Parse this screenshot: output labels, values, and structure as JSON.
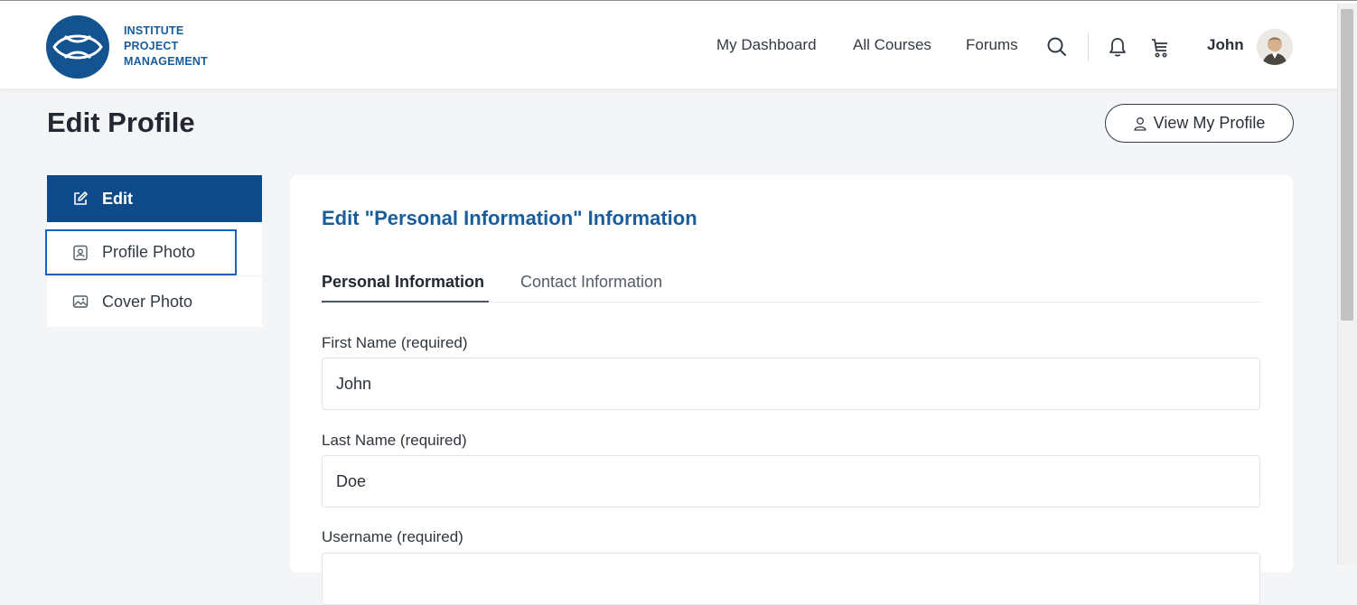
{
  "brand": {
    "logo_lines": [
      "INSTITUTE",
      "PROJECT",
      "MANAGEMENT"
    ],
    "color": "#1a5d9b"
  },
  "nav": {
    "links": [
      "My Dashboard",
      "All Courses",
      "Forums"
    ],
    "icons": [
      "search-icon",
      "bell-icon",
      "cart-icon"
    ],
    "user_name": "John"
  },
  "page": {
    "title": "Edit Profile",
    "view_profile_label": "View My Profile"
  },
  "sidebar": {
    "items": [
      {
        "label": "Edit",
        "icon": "edit-icon",
        "active": true
      },
      {
        "label": "Profile Photo",
        "icon": "profile-photo-icon",
        "active": false
      },
      {
        "label": "Cover Photo",
        "icon": "cover-photo-icon",
        "active": false
      }
    ]
  },
  "form": {
    "section_title": "Edit \"Personal Information\" Information",
    "tabs": [
      {
        "label": "Personal Information",
        "active": true
      },
      {
        "label": "Contact Information",
        "active": false
      }
    ],
    "fields": [
      {
        "label": "First Name (required)",
        "value": "John"
      },
      {
        "label": "Last Name (required)",
        "value": "Doe"
      },
      {
        "label": "Username (required)",
        "value": ""
      }
    ]
  },
  "colors": {
    "accent": "#0f4b8a",
    "heading": "#1a5d9b",
    "highlight_outline": "#1565c0"
  }
}
